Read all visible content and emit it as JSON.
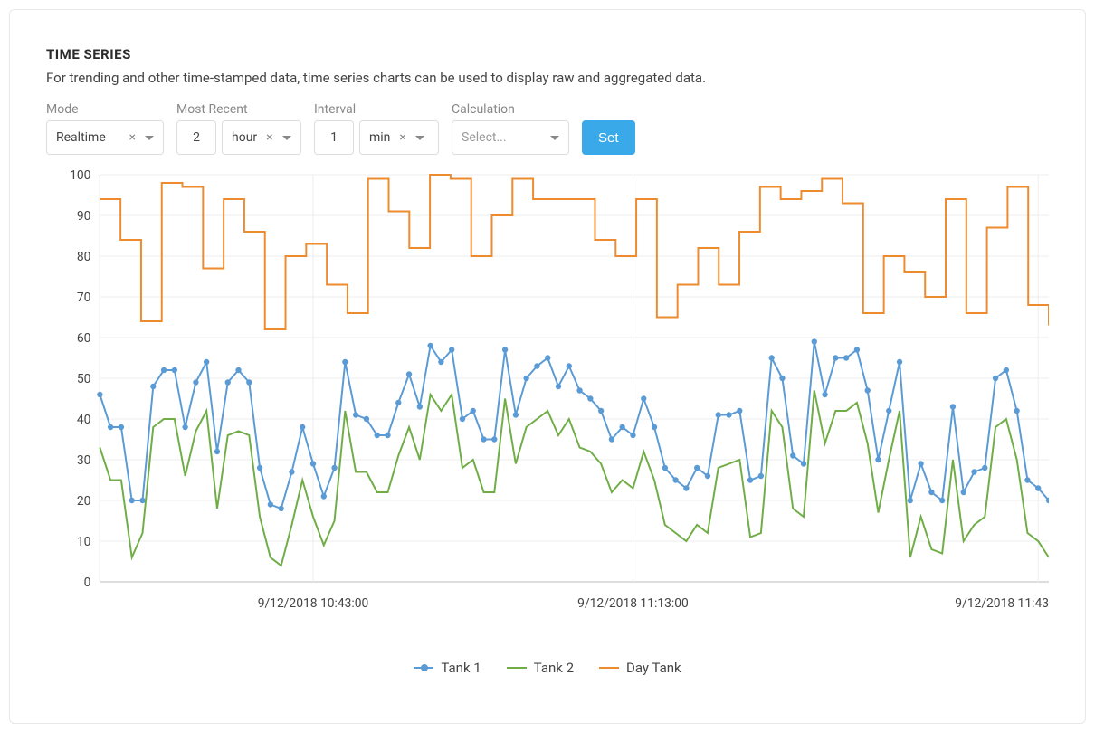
{
  "header": {
    "title": "TIME SERIES",
    "subtitle": "For trending and other time-stamped data, time series charts can be used to display raw and aggregated data."
  },
  "controls": {
    "mode": {
      "label": "Mode",
      "value": "Realtime"
    },
    "most_recent": {
      "label": "Most Recent",
      "value": "2",
      "unit": "hour"
    },
    "interval": {
      "label": "Interval",
      "value": "1",
      "unit": "min"
    },
    "calculation": {
      "label": "Calculation",
      "placeholder": "Select..."
    },
    "set_label": "Set"
  },
  "chart_data": {
    "type": "line",
    "ylabel": "",
    "xlabel": "",
    "ylim": [
      0,
      100
    ],
    "yticks": [
      0,
      10,
      20,
      30,
      40,
      50,
      60,
      70,
      80,
      90,
      100
    ],
    "xticks": [
      "9/12/2018 10:43:00",
      "9/12/2018 11:13:00",
      "9/12/2018 11:43"
    ],
    "n_points": 90,
    "legend": [
      "Tank 1",
      "Tank 2",
      "Day Tank"
    ],
    "series": [
      {
        "name": "Tank 1",
        "color": "#5b9bd5",
        "markers": true,
        "values": [
          46,
          38,
          38,
          20,
          20,
          48,
          52,
          52,
          38,
          49,
          54,
          32,
          49,
          52,
          49,
          28,
          19,
          18,
          27,
          38,
          29,
          21,
          28,
          54,
          41,
          40,
          36,
          36,
          44,
          51,
          43,
          58,
          54,
          57,
          40,
          42,
          35,
          35,
          57,
          41,
          50,
          53,
          55,
          48,
          53,
          47,
          45,
          42,
          35,
          38,
          36,
          45,
          38,
          28,
          25,
          23,
          28,
          26,
          41,
          41,
          42,
          25,
          26,
          55,
          50,
          31,
          29,
          59,
          46,
          55,
          55,
          57,
          47,
          30,
          42,
          54,
          20,
          29,
          22,
          20,
          43,
          22,
          27,
          28,
          50,
          52,
          42,
          25,
          23,
          20
        ]
      },
      {
        "name": "Tank 2",
        "color": "#70ad47",
        "markers": false,
        "values": [
          33,
          25,
          25,
          6,
          12,
          38,
          40,
          40,
          26,
          37,
          42,
          18,
          36,
          37,
          36,
          16,
          6,
          4,
          14,
          25,
          16,
          9,
          15,
          42,
          27,
          27,
          22,
          22,
          31,
          38,
          30,
          46,
          42,
          46,
          28,
          30,
          22,
          22,
          45,
          29,
          38,
          40,
          42,
          36,
          40,
          33,
          32,
          29,
          22,
          25,
          23,
          32,
          25,
          14,
          12,
          10,
          14,
          12,
          28,
          29,
          30,
          11,
          12,
          42,
          38,
          18,
          16,
          47,
          34,
          42,
          42,
          44,
          34,
          17,
          30,
          42,
          6,
          16,
          8,
          7,
          30,
          10,
          14,
          16,
          38,
          40,
          30,
          12,
          10,
          6
        ]
      },
      {
        "name": "Day Tank",
        "color": "#ed8b2e",
        "markers": false,
        "step": true,
        "values": [
          94,
          94,
          84,
          84,
          64,
          64,
          98,
          98,
          97,
          97,
          77,
          77,
          94,
          94,
          86,
          86,
          62,
          62,
          80,
          80,
          83,
          83,
          73,
          73,
          66,
          66,
          99,
          99,
          91,
          91,
          82,
          82,
          100,
          100,
          99,
          99,
          80,
          80,
          90,
          90,
          99,
          99,
          94,
          94,
          94,
          94,
          94,
          94,
          84,
          84,
          80,
          80,
          94,
          94,
          65,
          65,
          73,
          73,
          82,
          82,
          73,
          73,
          86,
          86,
          97,
          97,
          94,
          94,
          96,
          96,
          99,
          99,
          93,
          93,
          66,
          66,
          80,
          80,
          76,
          76,
          70,
          70,
          94,
          94,
          66,
          66,
          87,
          87,
          97,
          97,
          68,
          68,
          63
        ]
      }
    ]
  }
}
